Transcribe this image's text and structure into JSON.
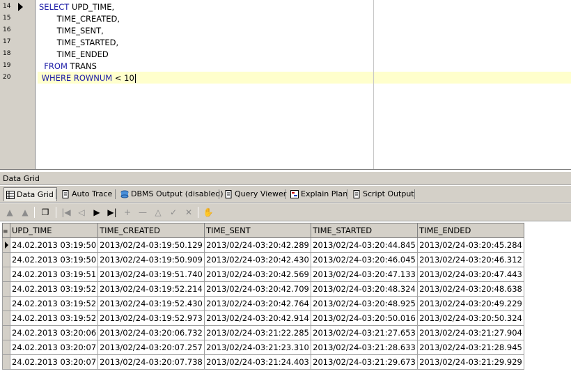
{
  "editor": {
    "line_numbers": [
      "14",
      "15",
      "16",
      "17",
      "18",
      "19",
      "20"
    ],
    "lines": [
      {
        "kw": "SELECT",
        "text": " UPD_TIME,"
      },
      {
        "kw": "",
        "text": "       TIME_CREATED,"
      },
      {
        "kw": "",
        "text": "       TIME_SENT,"
      },
      {
        "kw": "",
        "text": "       TIME_STARTED,"
      },
      {
        "kw": "",
        "text": "       TIME_ENDED"
      },
      {
        "kw": "  FROM",
        "text": " TRANS"
      },
      {
        "kw": " WHERE ROWNUM",
        "text": " < 10"
      }
    ]
  },
  "panel": {
    "title": "Data Grid"
  },
  "tabs": [
    {
      "label": "Data Grid",
      "icon": "grid-icon"
    },
    {
      "label": "Auto Trace",
      "icon": "page-icon"
    },
    {
      "label": "DBMS Output (disabled)",
      "icon": "dbms-icon"
    },
    {
      "label": "Query Viewer",
      "icon": "page-icon"
    },
    {
      "label": "Explain Plan",
      "icon": "plan-icon"
    },
    {
      "label": "Script Output",
      "icon": "page-icon"
    }
  ],
  "toolbar_icons": [
    "import-icon",
    "export-icon",
    "copy-icon",
    "first-icon",
    "prev-icon",
    "next-icon",
    "last-icon",
    "insert-icon",
    "delete-icon",
    "edit-icon",
    "post-icon",
    "cancel-icon",
    "hand-icon"
  ],
  "grid": {
    "columns": [
      "UPD_TIME",
      "TIME_CREATED",
      "TIME_SENT",
      "TIME_STARTED",
      "TIME_ENDED"
    ],
    "rows": [
      [
        "24.02.2013 03:19:50",
        "2013/02/24-03:19:50.129",
        "2013/02/24-03:20:42.289",
        "2013/02/24-03:20:44.845",
        "2013/02/24-03:20:45.284"
      ],
      [
        "24.02.2013 03:19:50",
        "2013/02/24-03:19:50.909",
        "2013/02/24-03:20:42.430",
        "2013/02/24-03:20:46.045",
        "2013/02/24-03:20:46.312"
      ],
      [
        "24.02.2013 03:19:51",
        "2013/02/24-03:19:51.740",
        "2013/02/24-03:20:42.569",
        "2013/02/24-03:20:47.133",
        "2013/02/24-03:20:47.443"
      ],
      [
        "24.02.2013 03:19:52",
        "2013/02/24-03:19:52.214",
        "2013/02/24-03:20:42.709",
        "2013/02/24-03:20:48.324",
        "2013/02/24-03:20:48.638"
      ],
      [
        "24.02.2013 03:19:52",
        "2013/02/24-03:19:52.430",
        "2013/02/24-03:20:42.764",
        "2013/02/24-03:20:48.925",
        "2013/02/24-03:20:49.229"
      ],
      [
        "24.02.2013 03:19:52",
        "2013/02/24-03:19:52.973",
        "2013/02/24-03:20:42.914",
        "2013/02/24-03:20:50.016",
        "2013/02/24-03:20:50.324"
      ],
      [
        "24.02.2013 03:20:06",
        "2013/02/24-03:20:06.732",
        "2013/02/24-03:21:22.285",
        "2013/02/24-03:21:27.653",
        "2013/02/24-03:21:27.904"
      ],
      [
        "24.02.2013 03:20:07",
        "2013/02/24-03:20:07.257",
        "2013/02/24-03:21:23.310",
        "2013/02/24-03:21:28.633",
        "2013/02/24-03:21:28.945"
      ],
      [
        "24.02.2013 03:20:07",
        "2013/02/24-03:20:07.738",
        "2013/02/24-03:21:24.403",
        "2013/02/24-03:21:29.673",
        "2013/02/24-03:21:29.929"
      ]
    ]
  }
}
